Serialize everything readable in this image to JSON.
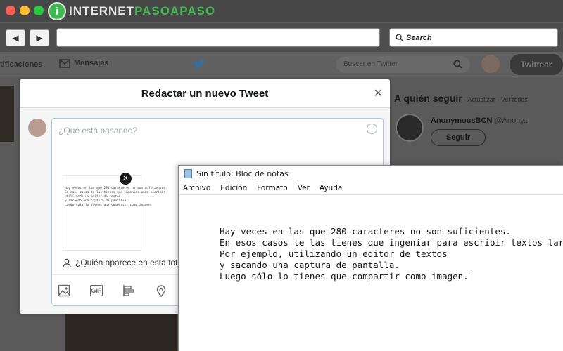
{
  "browser": {
    "logo_letter": "i",
    "logo_text_a": "INTERNET",
    "logo_text_b": "PASOAPASO",
    "back_glyph": "◀",
    "forward_glyph": "▶",
    "search_placeholder": "Search",
    "search_icon": "search-icon"
  },
  "twitter": {
    "nav_notifications": "tificaciones",
    "nav_messages": "Mensajes",
    "search_placeholder": "Buscar en Twitter",
    "tweet_button": "Twittear",
    "follow_title": "A quién seguir",
    "follow_actions": " · Actualizar · Ver todos",
    "follow_name": "AnonymousBCN",
    "follow_handle": "@Anony...",
    "follow_button": "Seguir"
  },
  "compose": {
    "title": "Redactar un nuevo Tweet",
    "close_glyph": "✕",
    "placeholder": "¿Qué está pasando?",
    "thumb_text": "Hay veces en las que 280 caracteres no son suficientes.\nEn esos casos te las tienes que ingeniar para escribir\nutilizando un editor de textos\ny sacando una captura de pantalla.\nLuego sólo lo tienes que compartir como imagen.",
    "remove_glyph": "✕",
    "tag_people": "¿Quién aparece en esta foto?",
    "tools": [
      "image-icon",
      "gif-icon",
      "poll-icon",
      "location-icon"
    ],
    "gif_label": "GIF"
  },
  "notepad": {
    "title": "Sin título: Bloc de notas",
    "menu": [
      "Archivo",
      "Edición",
      "Formato",
      "Ver",
      "Ayuda"
    ],
    "lines": [
      "Hay veces en las que 280 caracteres no son suficientes.",
      "En esos casos te las tienes que ingeniar para escribir textos largos.",
      "Por ejemplo, utilizando un editor de textos",
      "y sacando una captura de pantalla.",
      "Luego sólo lo tienes que compartir como imagen."
    ]
  },
  "colors": {
    "logo_green": "#3fb94f",
    "twitter_blue": "#1da1f2"
  }
}
